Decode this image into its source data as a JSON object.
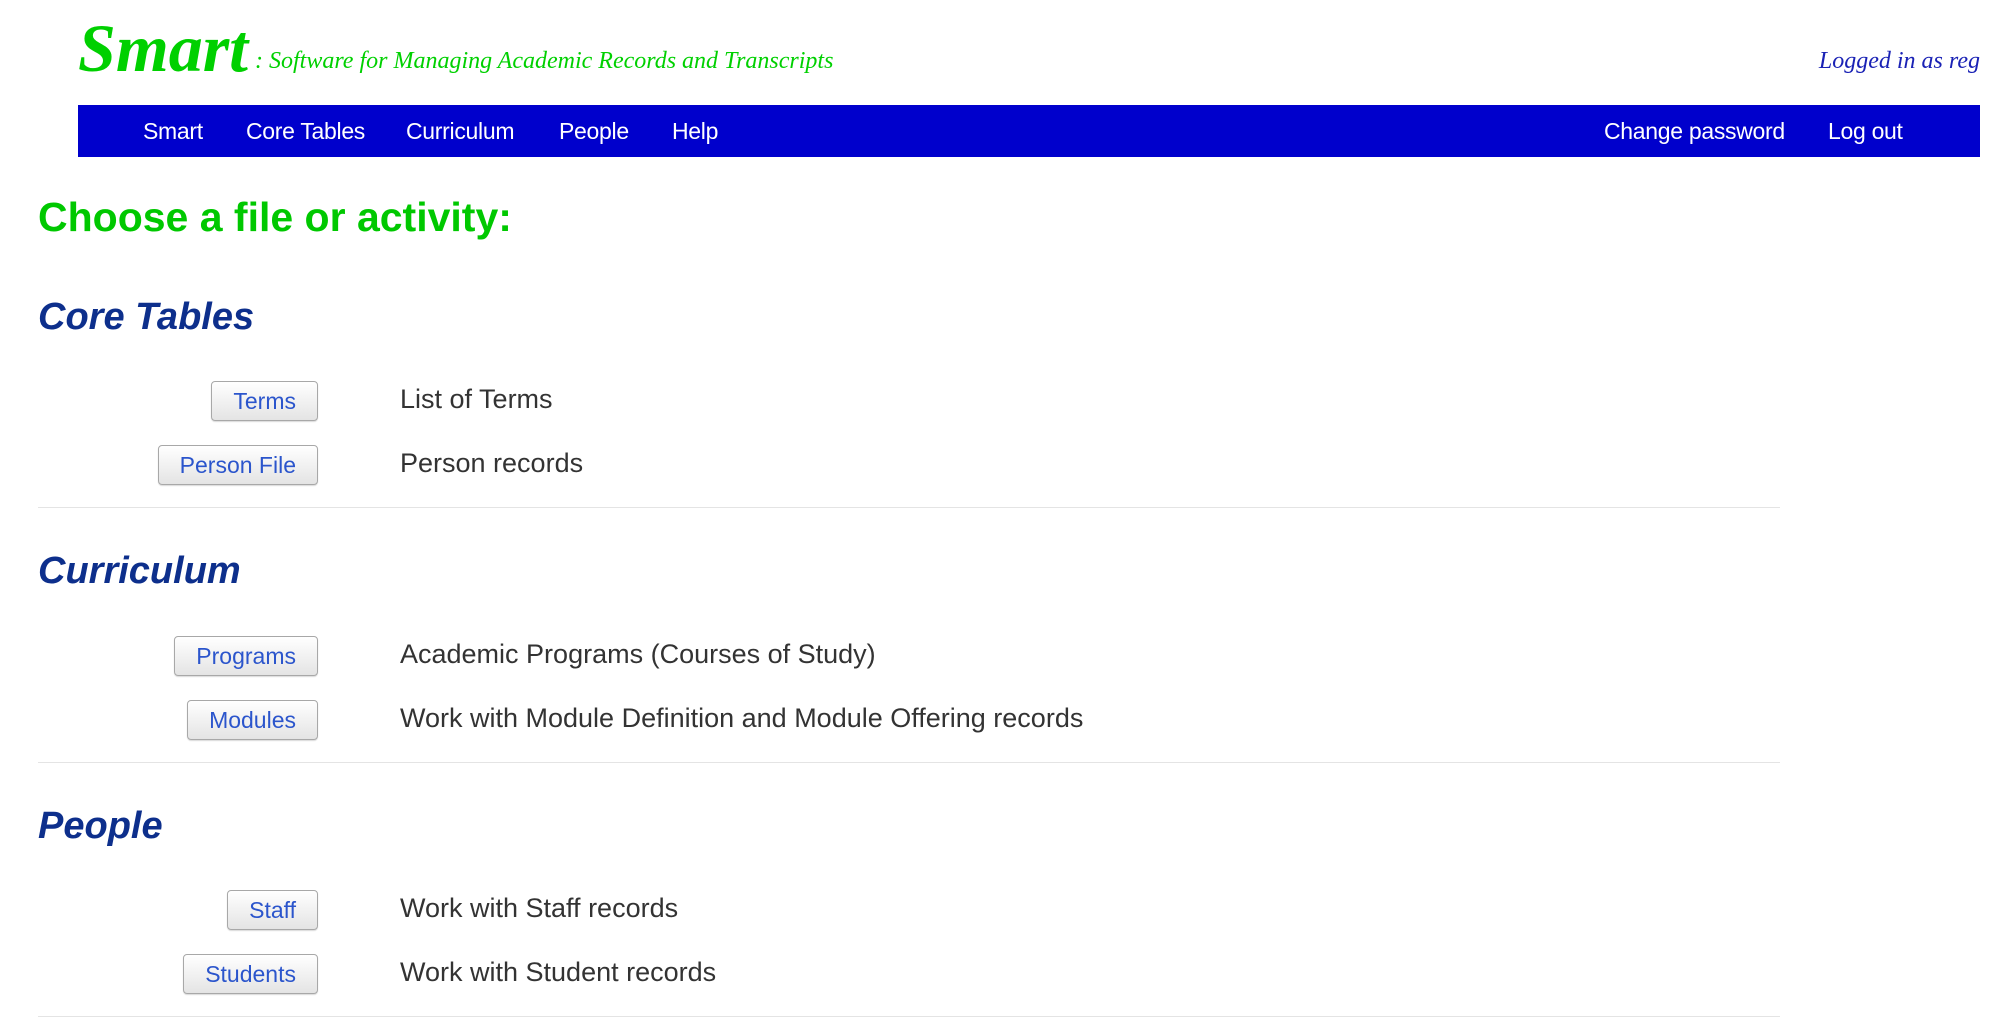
{
  "header": {
    "logo": "Smart",
    "tagline": ": Software for Managing Academic Records and Transcripts",
    "logged_in": "Logged in as reg"
  },
  "nav": {
    "left": [
      "Smart",
      "Core Tables",
      "Curriculum",
      "People",
      "Help"
    ],
    "right": [
      "Change password",
      "Log out"
    ]
  },
  "page_title": "Choose a file or activity:",
  "sections": [
    {
      "heading": "Core Tables",
      "rows": [
        {
          "button": "Terms",
          "description": "List of Terms"
        },
        {
          "button": "Person File",
          "description": "Person records"
        }
      ]
    },
    {
      "heading": "Curriculum",
      "rows": [
        {
          "button": "Programs",
          "description": "Academic Programs (Courses of Study)"
        },
        {
          "button": "Modules",
          "description": "Work with Module Definition and Module Offering records"
        }
      ]
    },
    {
      "heading": "People",
      "rows": [
        {
          "button": "Staff",
          "description": "Work with Staff records"
        },
        {
          "button": "Students",
          "description": "Work with Student records"
        }
      ]
    }
  ],
  "colors": {
    "brand_green": "#00d000",
    "nav_blue": "#0000cc",
    "heading_blue": "#0d2f8c",
    "button_text": "#2b55cc"
  }
}
